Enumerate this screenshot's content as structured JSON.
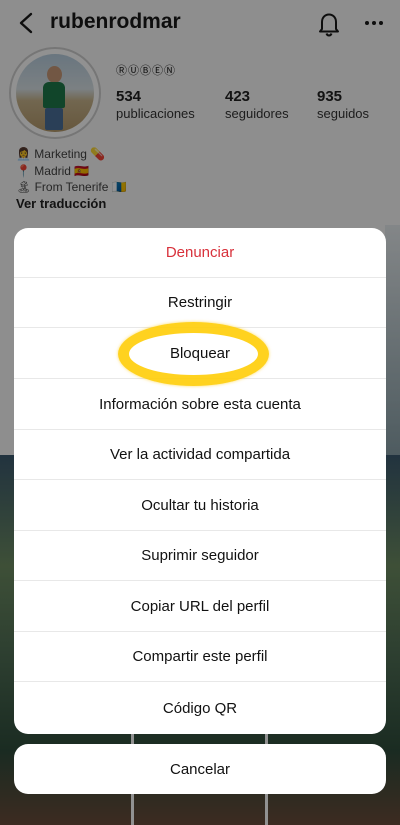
{
  "header": {
    "username": "rubenrodmar",
    "back_icon": "chevron-left-icon",
    "bell_icon": "bell-icon",
    "more_icon": "more-horizontal-icon"
  },
  "profile": {
    "badges": "ⓇⓊⒷⒺⓃ",
    "stats": [
      {
        "value": "534",
        "label": "publicaciones"
      },
      {
        "value": "423",
        "label": "seguidores"
      },
      {
        "value": "935",
        "label": "seguidos"
      }
    ],
    "bio": [
      "👩‍💼 Marketing 💊",
      "📍 Madrid 🇪🇸",
      "🏝 From Tenerife 🇮🇨"
    ],
    "translate_label": "Ver traducción"
  },
  "sheet": {
    "options": [
      {
        "label": "Denunciar",
        "danger": true
      },
      {
        "label": "Restringir"
      },
      {
        "label": "Bloquear"
      },
      {
        "label": "Información sobre esta cuenta"
      },
      {
        "label": "Ver la actividad compartida"
      },
      {
        "label": "Ocultar tu historia"
      },
      {
        "label": "Suprimir seguidor"
      },
      {
        "label": "Copiar URL del perfil"
      },
      {
        "label": "Compartir este perfil"
      },
      {
        "label": "Código QR"
      }
    ],
    "cancel_label": "Cancelar"
  },
  "colors": {
    "danger": "#d8313b",
    "highlight": "#ffcc00"
  }
}
